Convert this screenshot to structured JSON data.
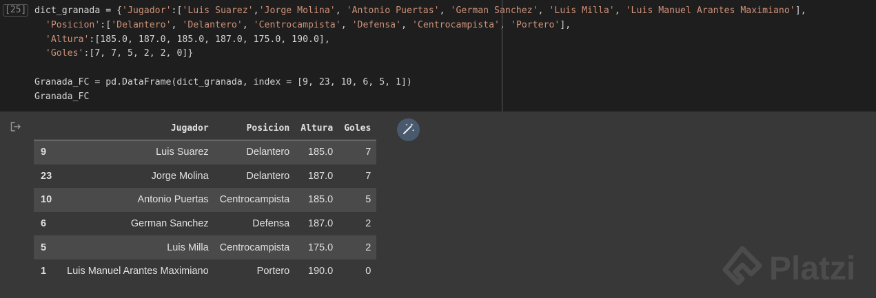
{
  "cell": {
    "execution_count": "[25]",
    "code": {
      "l1_var": "dict_granada = {",
      "l1_key": "'Jugador'",
      "l1_sep": ":[",
      "l1_v1": "'Luis Suarez'",
      "l1_c1": ",",
      "l1_v2": "'Jorge Molina'",
      "l1_c2": ", ",
      "l1_v3": "'Antonio Puertas'",
      "l1_c3": ", ",
      "l1_v4": "'German Sanchez'",
      "l1_c4": ", ",
      "l1_v5": "'Luis Milla'",
      "l1_c5": ", ",
      "l1_v6": "'Luis Manuel Arantes Maximiano'",
      "l1_end": "],",
      "l2_indent": "  ",
      "l2_key": "'Posicion'",
      "l2_sep": ":[",
      "l2_v1": "'Delantero'",
      "l2_c1": ", ",
      "l2_v2": "'Delantero'",
      "l2_c2": ", ",
      "l2_v3": "'Centrocampista'",
      "l2_c3": ", ",
      "l2_v4": "'Defensa'",
      "l2_c4": ", ",
      "l2_v5": "'Centrocampista'",
      "l2_c5": ", ",
      "l2_v6": "'Portero'",
      "l2_end": "],",
      "l3_indent": "  ",
      "l3_key": "'Altura'",
      "l3_rest": ":[185.0, 187.0, 185.0, 187.0, 175.0, 190.0],",
      "l4_indent": "  ",
      "l4_key": "'Goles'",
      "l4_rest": ":[7, 7, 5, 2, 2, 0]}",
      "l6": "Granada_FC = pd.DataFrame(dict_granada, index = [9, 23, 10, 6, 5, 1])",
      "l7": "Granada_FC"
    }
  },
  "output": {
    "columns": [
      "Jugador",
      "Posicion",
      "Altura",
      "Goles"
    ],
    "rows": [
      {
        "index": "9",
        "Jugador": "Luis Suarez",
        "Posicion": "Delantero",
        "Altura": "185.0",
        "Goles": "7"
      },
      {
        "index": "23",
        "Jugador": "Jorge Molina",
        "Posicion": "Delantero",
        "Altura": "187.0",
        "Goles": "7"
      },
      {
        "index": "10",
        "Jugador": "Antonio Puertas",
        "Posicion": "Centrocampista",
        "Altura": "185.0",
        "Goles": "5"
      },
      {
        "index": "6",
        "Jugador": "German Sanchez",
        "Posicion": "Defensa",
        "Altura": "187.0",
        "Goles": "2"
      },
      {
        "index": "5",
        "Jugador": "Luis Milla",
        "Posicion": "Centrocampista",
        "Altura": "175.0",
        "Goles": "2"
      },
      {
        "index": "1",
        "Jugador": "Luis Manuel Arantes Maximiano",
        "Posicion": "Portero",
        "Altura": "190.0",
        "Goles": "0"
      }
    ]
  },
  "icons": {
    "output_icon": "output-arrow-icon",
    "wand_icon": "magic-wand-icon",
    "watermark_icon": "platzi-logo-icon"
  },
  "watermark": {
    "text": "Platzi"
  },
  "colors": {
    "code_bg": "#1e1e1e",
    "output_bg": "#383838",
    "string": "#ce9178",
    "number": "#b5cea8",
    "stripe": "#4a4a4a"
  }
}
